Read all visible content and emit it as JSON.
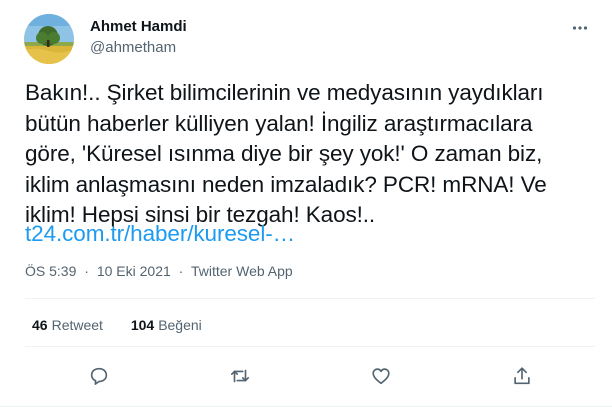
{
  "author": {
    "display_name": "Ahmet Hamdi",
    "handle": "@ahmetham",
    "avatar": "avatar-landscape-tree"
  },
  "tweet": {
    "text": "Bakın!.. Şirket bilimcilerinin ve medyasının yaydıkları\nbütün haberler külliyen yalan! İngiliz araştırmacılara\ngöre, 'Küresel ısınma diye bir şey yok!' O zaman biz,\niklim anlaşmasını neden imzaladık? PCR! mRNA! Ve\niklim! Hepsi sinsi bir tezgah! Kaos!..",
    "link": "t24.com.tr/haber/kuresel-…"
  },
  "meta": {
    "time": "ÖS 5:39",
    "separator": "·",
    "date": "10 Eki 2021",
    "source": "Twitter Web App"
  },
  "stats": {
    "retweets_count": "46",
    "retweets_label": "Retweet",
    "likes_count": "104",
    "likes_label": "Beğeni"
  },
  "actions": [
    "reply-icon",
    "retweet-icon",
    "like-icon",
    "share-icon"
  ],
  "colors": {
    "text": "#0f1419",
    "secondary": "#536471",
    "link": "#1d9bf0",
    "divider": "#eff3f4"
  }
}
